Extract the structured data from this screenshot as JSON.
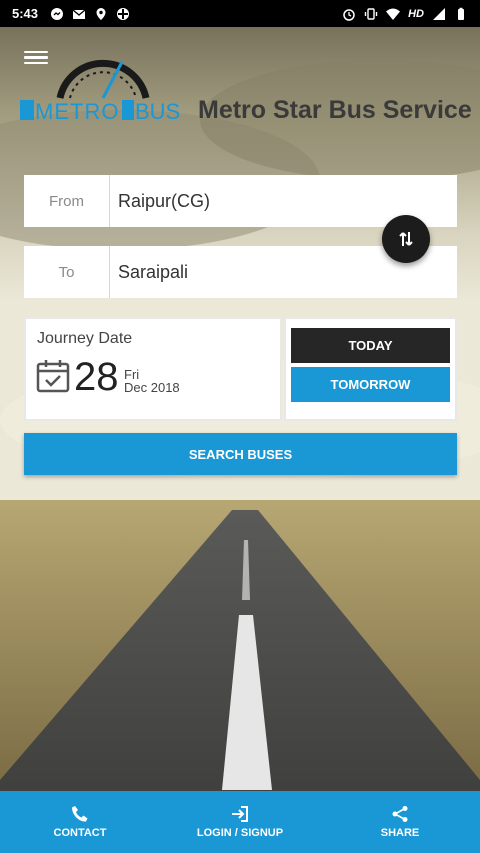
{
  "status_bar": {
    "time": "5:43",
    "hd_label": "HD",
    "left_icons": [
      "messenger-icon",
      "gmail-icon",
      "location-icon",
      "app-icon"
    ],
    "right_icons": [
      "alarm-icon",
      "vibrate-icon",
      "wifi-icon",
      "signal-icon",
      "battery-icon"
    ]
  },
  "header": {
    "logo_text_left": "METRO",
    "logo_text_right": "BUS",
    "brand_title": "Metro Star Bus Service"
  },
  "form": {
    "from_label": "From",
    "from_value": "Raipur(CG)",
    "to_label": "To",
    "to_value": "Saraipali",
    "swap_icon": "swap-vertical-icon"
  },
  "journey": {
    "label": "Journey Date",
    "day": "28",
    "weekday": "Fri",
    "month_year": "Dec 2018",
    "today_label": "TODAY",
    "tomorrow_label": "TOMORROW"
  },
  "search_label": "SEARCH BUSES",
  "bottom_nav": {
    "contact": "CONTACT",
    "login": "LOGIN / SIGNUP",
    "share": "SHARE"
  },
  "colors": {
    "accent": "#1a98d5",
    "dark_button": "#262626",
    "status_bar": "#000000"
  }
}
